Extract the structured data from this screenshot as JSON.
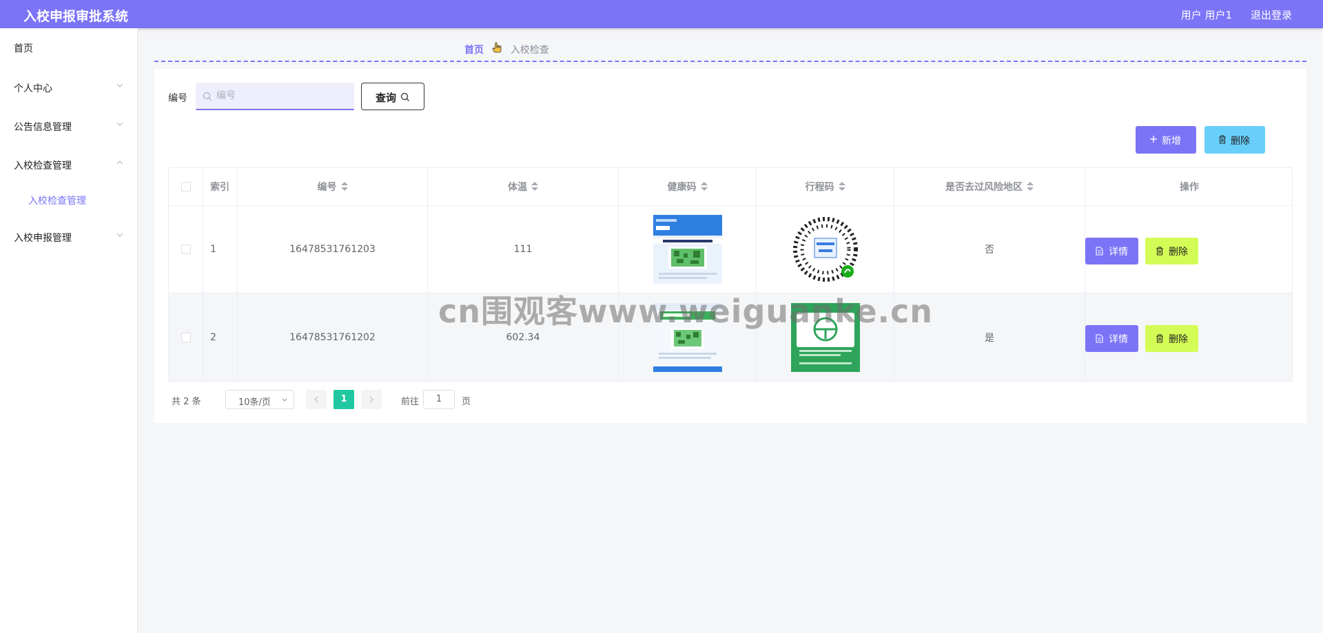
{
  "header": {
    "app_title": "入校申报审批系统",
    "user_info": "用户 用户1",
    "logout_label": "退出登录"
  },
  "sidebar": {
    "items": [
      {
        "label": "首页"
      },
      {
        "label": "个人中心"
      },
      {
        "label": "公告信息管理"
      },
      {
        "label": "入校检查管理"
      },
      {
        "label": "入校检查管理"
      },
      {
        "label": "入校申报管理"
      }
    ]
  },
  "breadcrumb": {
    "home": "首页",
    "current": "入校检查"
  },
  "search": {
    "label": "编号",
    "placeholder": "编号",
    "query_label": "查询"
  },
  "actions": {
    "add_label": "新增",
    "delete_label": "删除"
  },
  "table": {
    "headers": [
      "索引",
      "编号",
      "体温",
      "健康码",
      "行程码",
      "是否去过风险地区",
      "操作"
    ],
    "rows": [
      {
        "index": "1",
        "number": "16478531761203",
        "temperature": "111",
        "risk_area": "否",
        "detail_label": "详情",
        "delete_label": "删除"
      },
      {
        "index": "2",
        "number": "16478531761202",
        "temperature": "602.34",
        "risk_area": "是",
        "detail_label": "详情",
        "delete_label": "删除"
      }
    ]
  },
  "pagination": {
    "total": "共 2 条",
    "page_size": "10条/页",
    "current_page": "1",
    "goto_label": "前往",
    "goto_value": "1",
    "page_suffix": "页"
  },
  "watermark": "cn围观客www.weiguanke.cn",
  "colors": {
    "primary": "#7b74f7",
    "info": "#68cffb",
    "danger_lime": "#d4fc56",
    "pager_active": "#1fc8a0"
  }
}
